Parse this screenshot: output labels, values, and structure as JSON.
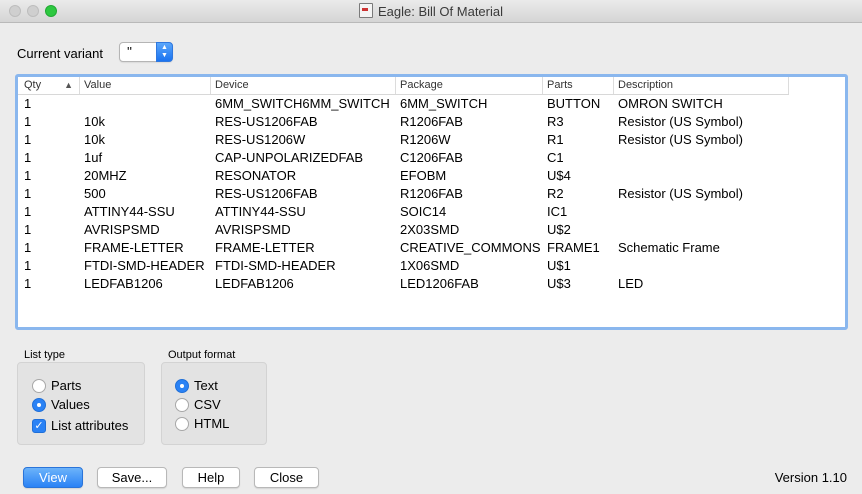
{
  "window": {
    "title": "Eagle: Bill Of Material"
  },
  "variant": {
    "label": "Current variant",
    "value": "''"
  },
  "table": {
    "columns": [
      "Qty",
      "Value",
      "Device",
      "Package",
      "Parts",
      "Description"
    ],
    "rows": [
      [
        "1",
        "",
        "6MM_SWITCH6MM_SWITCH",
        "6MM_SWITCH",
        "BUTTON",
        "OMRON SWITCH"
      ],
      [
        "1",
        "10k",
        "RES-US1206FAB",
        "R1206FAB",
        "R3",
        "Resistor (US Symbol)"
      ],
      [
        "1",
        "10k",
        "RES-US1206W",
        "R1206W",
        "R1",
        "Resistor (US Symbol)"
      ],
      [
        "1",
        "1uf",
        "CAP-UNPOLARIZEDFAB",
        "C1206FAB",
        "C1",
        ""
      ],
      [
        "1",
        "20MHZ",
        "RESONATOR",
        "EFOBM",
        "U$4",
        ""
      ],
      [
        "1",
        "500",
        "RES-US1206FAB",
        "R1206FAB",
        "R2",
        "Resistor (US Symbol)"
      ],
      [
        "1",
        "ATTINY44-SSU",
        "ATTINY44-SSU",
        "SOIC14",
        "IC1",
        ""
      ],
      [
        "1",
        "AVRISPSMD",
        "AVRISPSMD",
        "2X03SMD",
        "U$2",
        ""
      ],
      [
        "1",
        "FRAME-LETTER",
        "FRAME-LETTER",
        "CREATIVE_COMMONS",
        "FRAME1",
        "Schematic Frame"
      ],
      [
        "1",
        "FTDI-SMD-HEADER",
        "FTDI-SMD-HEADER",
        "1X06SMD",
        "U$1",
        ""
      ],
      [
        "1",
        "LEDFAB1206",
        "LEDFAB1206",
        "LED1206FAB",
        "U$3",
        "LED"
      ]
    ]
  },
  "list_type": {
    "title": "List type",
    "options": [
      {
        "label": "Parts",
        "selected": false
      },
      {
        "label": "Values",
        "selected": true
      }
    ],
    "list_attributes": {
      "label": "List attributes",
      "checked": true
    }
  },
  "output_format": {
    "title": "Output format",
    "options": [
      {
        "label": "Text",
        "selected": true
      },
      {
        "label": "CSV",
        "selected": false
      },
      {
        "label": "HTML",
        "selected": false
      }
    ]
  },
  "buttons": {
    "view": "View",
    "save": "Save...",
    "help": "Help",
    "close": "Close"
  },
  "version": "Version 1.10"
}
